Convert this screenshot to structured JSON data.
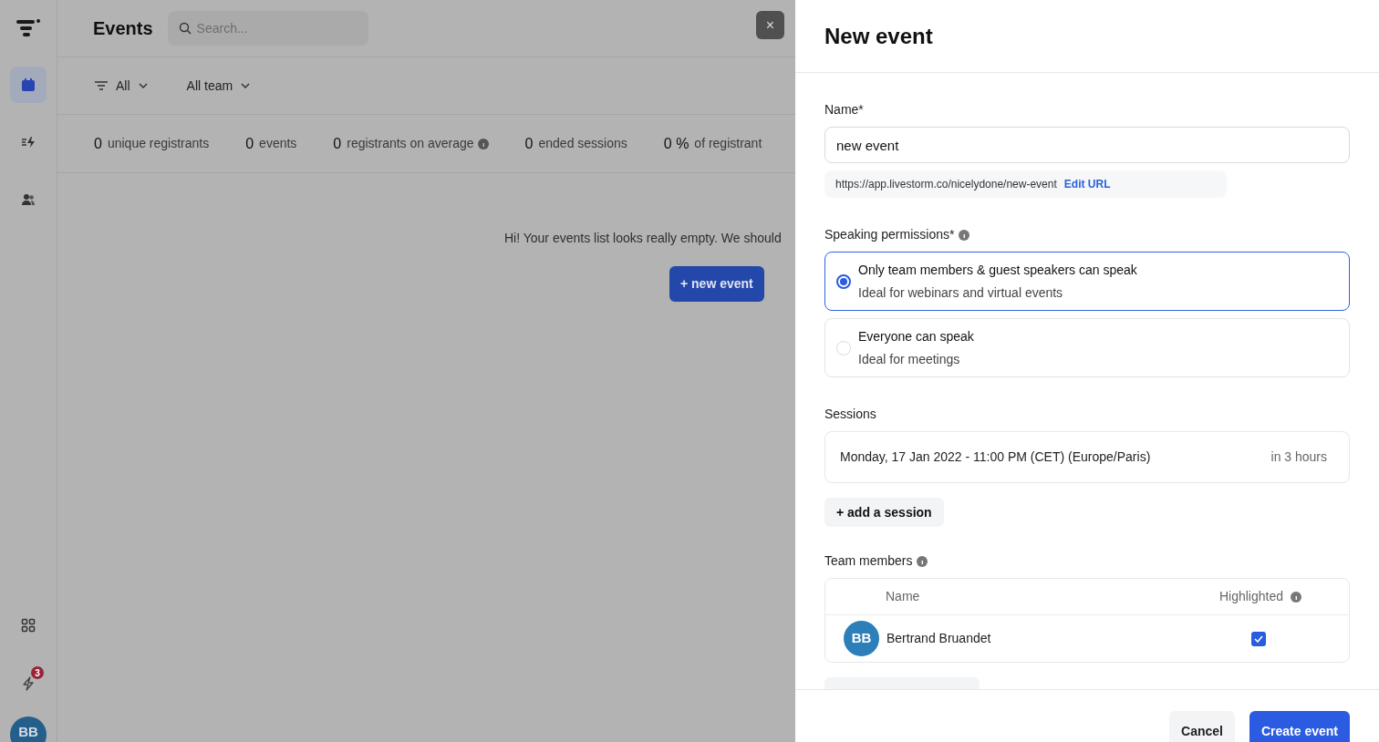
{
  "sidebar": {
    "items": [
      {
        "kind": "calendar",
        "selected": true
      },
      {
        "kind": "activity",
        "selected": false
      },
      {
        "kind": "people",
        "selected": false
      }
    ],
    "bottom_items": [
      {
        "kind": "apps"
      },
      {
        "kind": "lightning",
        "badge": "3"
      }
    ],
    "avatar": "BB"
  },
  "header": {
    "title": "Events",
    "search": {
      "placeholder": "Search..."
    }
  },
  "filters": [
    {
      "label": "All",
      "kind": "filter"
    },
    {
      "label": "All team",
      "kind": "plain"
    }
  ],
  "stats": [
    {
      "value": "0",
      "label": "unique registrants",
      "info": false
    },
    {
      "value": "0",
      "label": "events",
      "info": false
    },
    {
      "value": "0",
      "label": "registrants on average",
      "info": true
    },
    {
      "value": "0",
      "label": "ended sessions",
      "info": false
    },
    {
      "value": "0 %",
      "label": "of registrant",
      "info": false
    }
  ],
  "empty_state": {
    "message": "Hi! Your events list looks really empty. We should",
    "button": "+ new event"
  },
  "close_button": "×",
  "drawer": {
    "title": "New event",
    "name": {
      "label": "Name*",
      "value": "new event"
    },
    "url": {
      "text": "https://app.livestorm.co/nicelydone/new-event",
      "link": "Edit URL"
    },
    "speaking": {
      "label": "Speaking permissions*",
      "options": [
        {
          "title": "Only team members & guest speakers can speak",
          "description": "Ideal for webinars and virtual events",
          "selected": true
        },
        {
          "title": "Everyone can speak",
          "description": "Ideal for meetings",
          "selected": false
        }
      ]
    },
    "sessions": {
      "label": "Sessions",
      "items": [
        {
          "date": "Monday, 17 Jan 2022 - 11:00 PM (CET) (Europe/Paris)",
          "relative": "in 3 hours"
        }
      ],
      "add_button": "+ add a session"
    },
    "team": {
      "label": "Team members",
      "columns": [
        "Name",
        "Highlighted"
      ],
      "rows": [
        {
          "initials": "BB",
          "name": "Bertrand Bruandet",
          "highlighted": true
        }
      ]
    },
    "footer": {
      "cancel": "Cancel",
      "submit": "Create event"
    }
  }
}
